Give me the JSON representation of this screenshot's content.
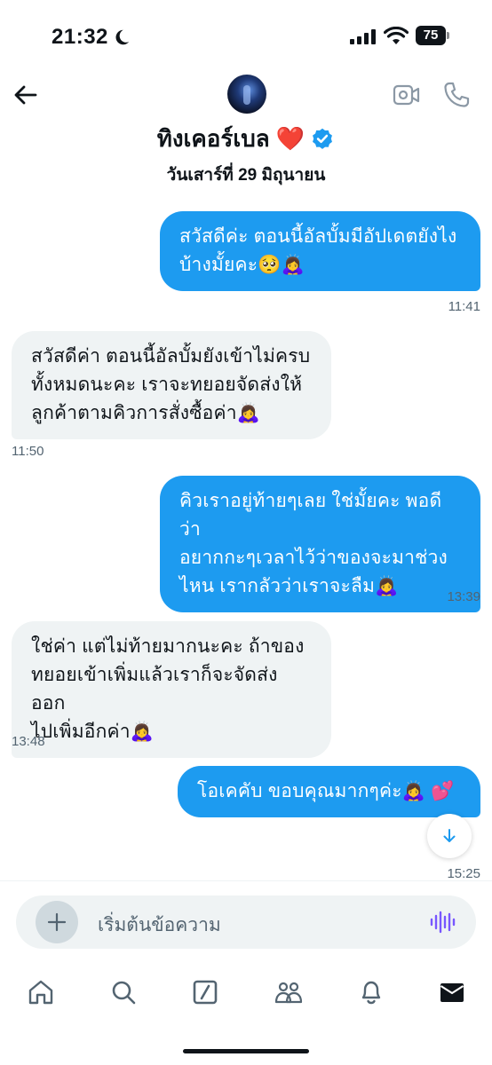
{
  "status_bar": {
    "time": "21:32",
    "battery": "75"
  },
  "header": {
    "name": "ทิงเคอร์เบล",
    "name_display": "ทิงเคอร์เบล ❤️",
    "date": "วันเสาร์ที่ 29 มิถุนายน",
    "accent_color": "#1d9bf0"
  },
  "messages": [
    {
      "direction": "out",
      "text": "สวัสดีค่ะ ตอนนี้อัลบั้มมีอัปเดตยังไงบ้างมั้ยคะ🥺🙇‍♀️",
      "lines": [
        "สวัสดีค่ะ ตอนนี้อัลบั้มมีอัปเดตยังไง",
        "บ้างมั้ยคะ🥺🙇‍♀️"
      ],
      "time": "11:41"
    },
    {
      "direction": "in",
      "text": "สวัสดีค่า ตอนนี้อัลบั้มยังเข้าไม่ครบทั้งหมดนะคะ เราจะทยอยจัดส่งให้ลูกค้าตามคิวการสั่งซื้อค่า🙇‍♀️",
      "lines": [
        "สวัสดีค่า ตอนนี้อัลบั้มยังเข้าไม่ครบ",
        "ทั้งหมดนะคะ เราจะทยอยจัดส่งให้",
        "ลูกค้าตามคิวการสั่งซื้อค่า🙇‍♀️"
      ],
      "time": "11:50"
    },
    {
      "direction": "out",
      "text": "คิวเราอยู่ท้ายๆเลย ใช่มั้ยคะ พอดีว่าอยากกะๆเวลาไว้ว่าของจะมาช่วงไหน เรากลัวว่าเราจะลืม🙇‍♀️",
      "lines": [
        "คิวเราอยู่ท้ายๆเลย ใช่มั้ยคะ พอดีว่า",
        "อยากกะๆเวลาไว้ว่าของจะมาช่วง",
        "ไหน เรากลัวว่าเราจะลืม🙇‍♀️"
      ],
      "time": "13:39"
    },
    {
      "direction": "in",
      "text": "ใช่ค่า แต่ไม่ท้ายมากนะคะ ถ้าของทยอยเข้าเพิ่มแล้วเราก็จะจัดส่งออกไปเพิ่มอีกค่า🙇‍♀️",
      "lines": [
        "ใช่ค่า แต่ไม่ท้ายมากนะคะ ถ้าของ",
        "ทยอยเข้าเพิ่มแล้วเราก็จะจัดส่งออก",
        "ไปเพิ่มอีกค่า🙇‍♀️"
      ],
      "time": "13:48"
    },
    {
      "direction": "out",
      "text": "โอเคคับ ขอบคุณมากๆค่ะ🙇‍♀️ 💕",
      "lines": [
        "โอเคคับ ขอบคุณมากๆค่ะ🙇‍♀️ 💕"
      ],
      "time": "15:25"
    }
  ],
  "composer": {
    "placeholder": "เริ่มต้นข้อความ"
  },
  "bottom_nav": [
    {
      "icon": "home-icon"
    },
    {
      "icon": "search-icon"
    },
    {
      "icon": "grok-icon"
    },
    {
      "icon": "communities-icon"
    },
    {
      "icon": "notifications-icon"
    },
    {
      "icon": "messages-icon",
      "active": true
    }
  ]
}
